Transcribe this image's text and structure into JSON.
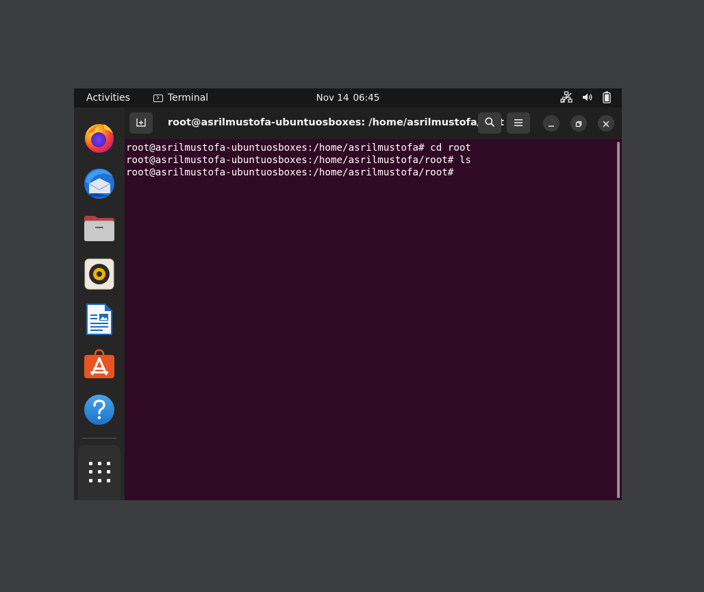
{
  "topbar": {
    "activities": "Activities",
    "app_name": "Terminal",
    "date": "Nov 14",
    "time": "06:45",
    "status_icons": [
      "network-icon",
      "volume-icon",
      "battery-icon"
    ]
  },
  "dock": {
    "items": [
      {
        "name": "firefox-icon",
        "app": "Firefox"
      },
      {
        "name": "thunderbird-icon",
        "app": "Thunderbird"
      },
      {
        "name": "files-icon",
        "app": "Files"
      },
      {
        "name": "rhythmbox-icon",
        "app": "Rhythmbox"
      },
      {
        "name": "libreoffice-writer-icon",
        "app": "LibreOffice Writer"
      },
      {
        "name": "app-center-icon",
        "app": "Ubuntu Software"
      },
      {
        "name": "help-icon",
        "app": "Help"
      }
    ],
    "show_apps_icon": "apps-grid-icon"
  },
  "window": {
    "title": "root@asrilmustofa-ubuntuosboxes: /home/asrilmustofa/root",
    "lines": [
      "root@asrilmustofa-ubuntuosboxes:/home/asrilmustofa# cd root",
      "root@asrilmustofa-ubuntuosboxes:/home/asrilmustofa/root# ls",
      "root@asrilmustofa-ubuntuosboxes:/home/asrilmustofa/root#"
    ]
  },
  "colors": {
    "terminal_bg": "#300a24",
    "topbar_bg": "#171717",
    "dock_bg": "#262626",
    "headerbar_bg": "#202020",
    "desktop_bg": "#3c3d3f"
  }
}
